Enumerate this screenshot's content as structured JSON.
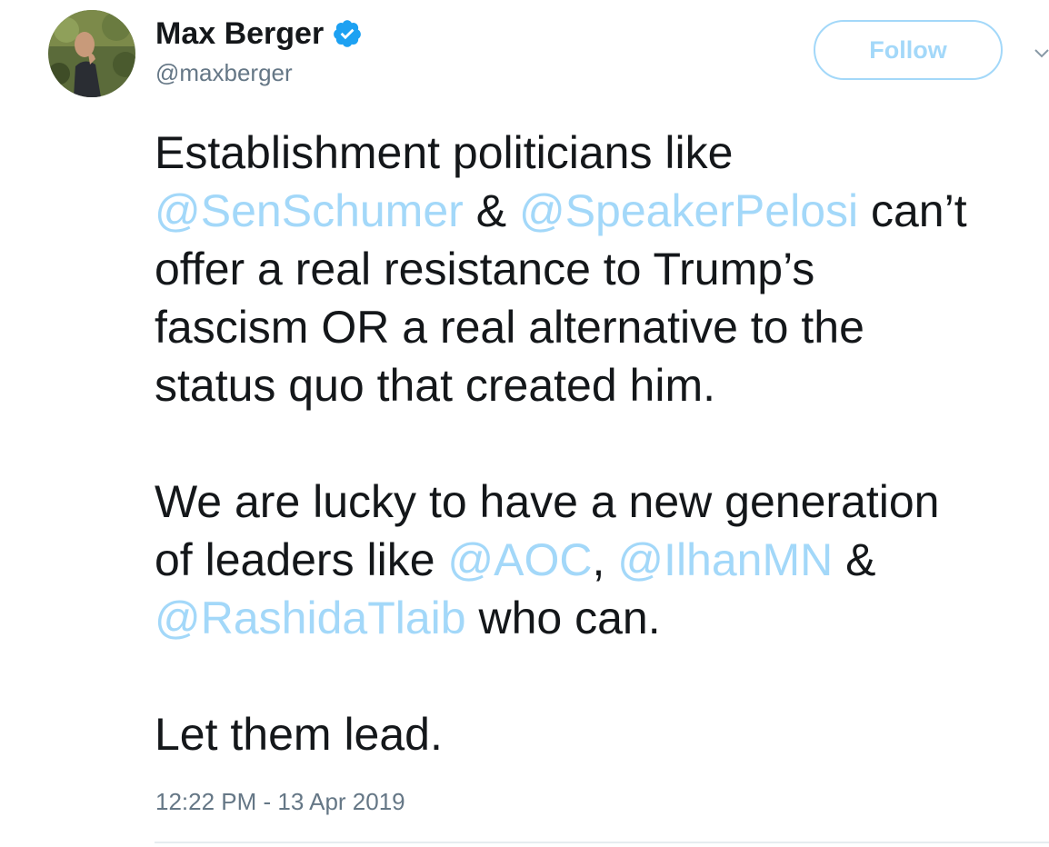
{
  "author": {
    "display_name": "Max Berger",
    "handle": "@maxberger",
    "verified_icon": "verified-badge-icon",
    "avatar_icon": "profile-photo"
  },
  "follow_button": {
    "label": "Follow"
  },
  "menu": {
    "icon": "chevron-down-icon"
  },
  "tweet": {
    "p1": {
      "l1": "Establishment politicians like",
      "l2_m1": "@SenSchumer",
      "l2_t1": " & ",
      "l2_m2": "@SpeakerPelosi",
      "l2_t2": " can’t",
      "l3": "offer a real resistance to Trump’s",
      "l4": "fascism OR a real alternative to the",
      "l5": "status quo that created him."
    },
    "p2": {
      "l1": "We are lucky to have a new generation",
      "l2_t1": "of leaders like ",
      "l2_m1": "@AOC",
      "l2_t2": ", ",
      "l2_m2": "@IlhanMN",
      "l2_t3": " &",
      "l3_m1": "@RashidaTlaib",
      "l3_t1": " who can."
    },
    "p3": {
      "l1": "Let them lead."
    }
  },
  "timestamp": "12:22 PM - 13 Apr 2019",
  "colors": {
    "text": "#14171a",
    "secondary": "#657786",
    "link": "#a3d8f9",
    "verified": "#1da1f2"
  }
}
